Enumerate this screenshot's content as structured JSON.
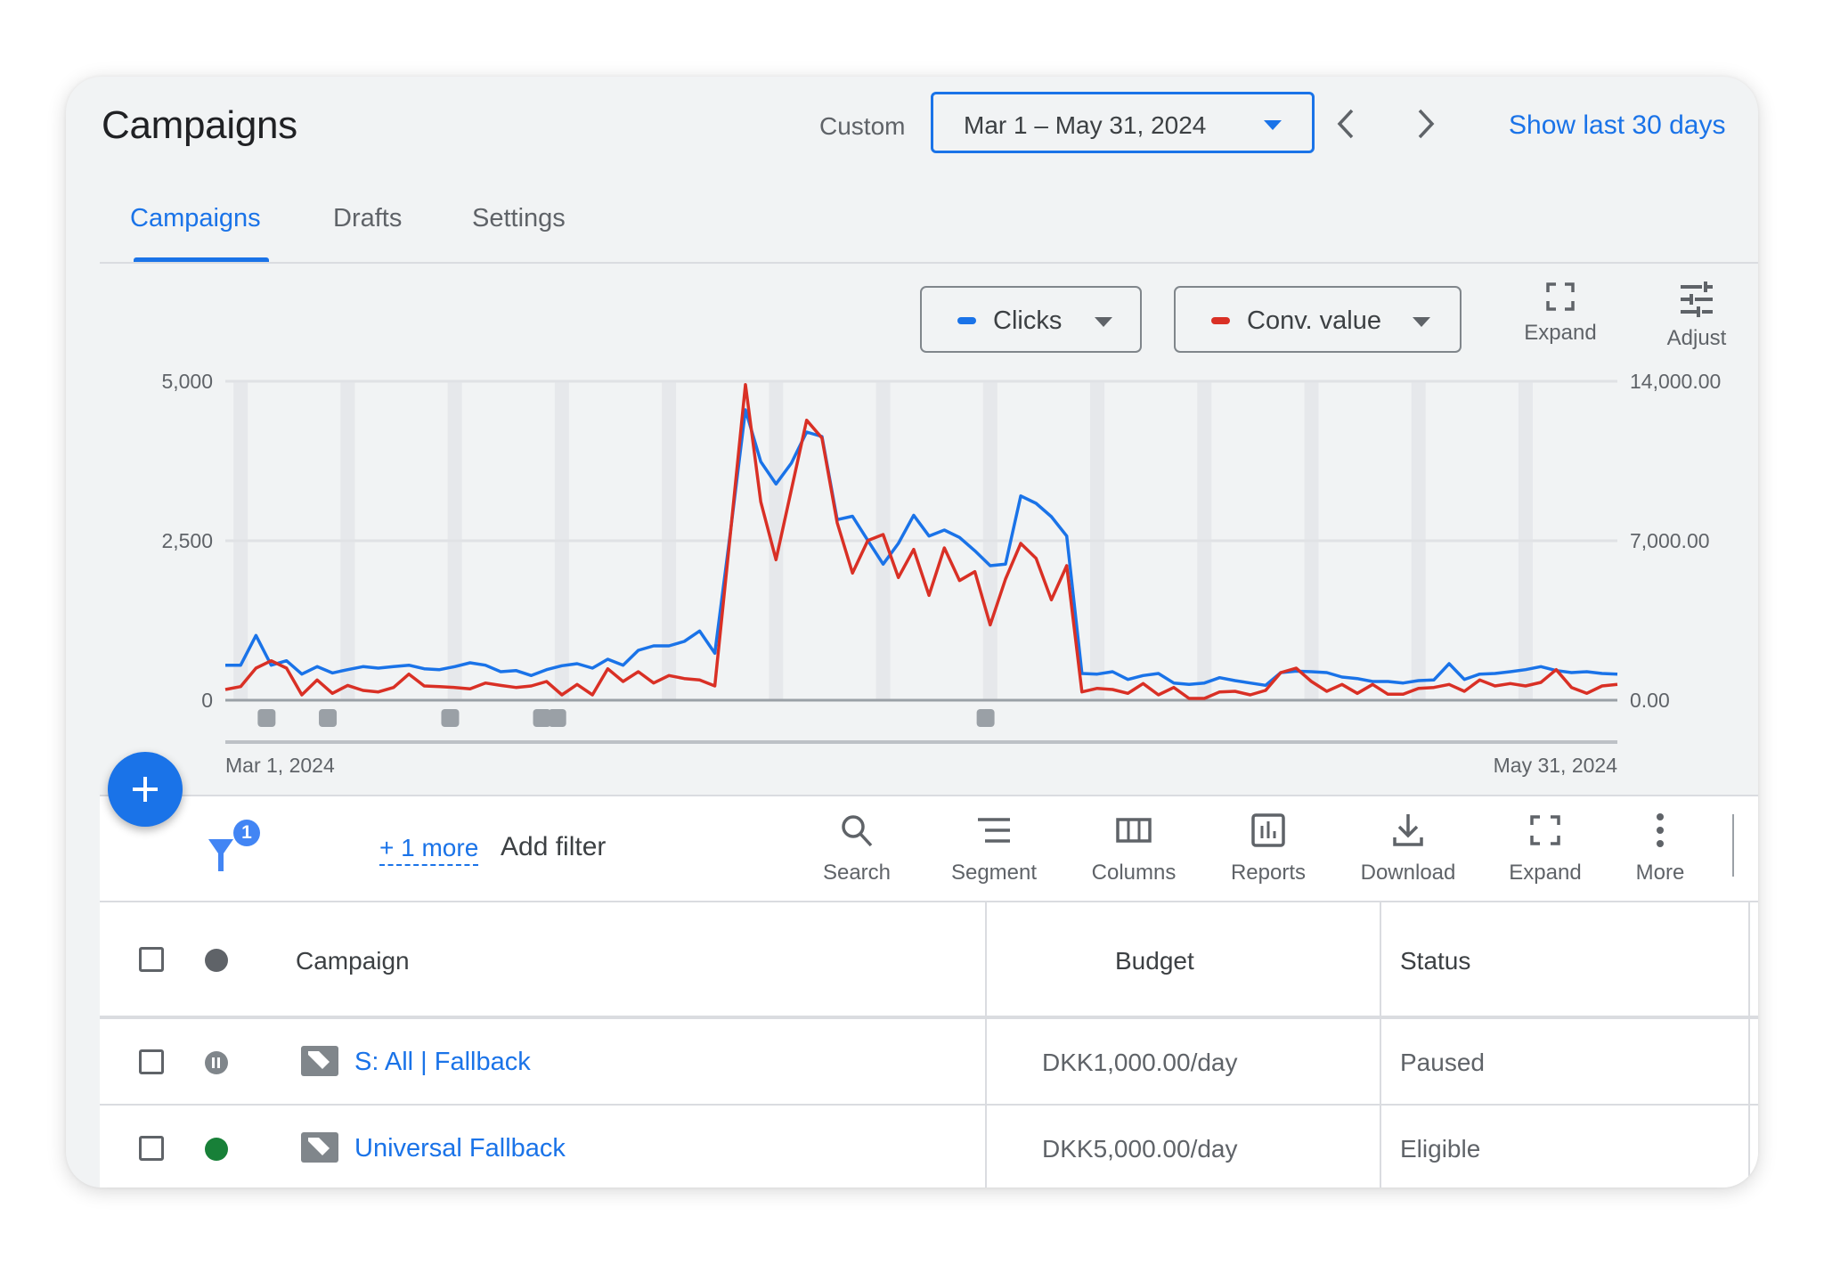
{
  "header": {
    "title": "Campaigns",
    "date_range_type": "Custom",
    "date_range": "Mar 1 – May 31, 2024",
    "show_last_link": "Show last 30 days"
  },
  "tabs": [
    {
      "label": "Campaigns",
      "active": true
    },
    {
      "label": "Drafts",
      "active": false
    },
    {
      "label": "Settings",
      "active": false
    }
  ],
  "chart_controls": {
    "metric1": {
      "label": "Clicks",
      "color": "#1a73e8"
    },
    "metric2": {
      "label": "Conv. value",
      "color": "#d93025"
    },
    "expand_label": "Expand",
    "adjust_label": "Adjust"
  },
  "chart_data": {
    "type": "line",
    "title": "",
    "xlabel": "",
    "x_start_label": "Mar 1, 2024",
    "x_end_label": "May 31, 2024",
    "grid": true,
    "legend": "top-right (metric selector chips)",
    "y_left": {
      "label": "Clicks",
      "ylim": [
        0,
        5000
      ],
      "ticks": [
        "0",
        "2,500",
        "5,000"
      ]
    },
    "y_right": {
      "label": "Conv. value",
      "ylim": [
        0,
        14000
      ],
      "ticks": [
        "0.00",
        "7,000.00",
        "14,000.00"
      ]
    },
    "series": [
      {
        "name": "Clicks",
        "axis": "left",
        "color": "#1a73e8",
        "values": [
          549,
          549,
          1015,
          549,
          619,
          409,
          526,
          428,
          479,
          526,
          503,
          526,
          549,
          493,
          479,
          526,
          587,
          549,
          447,
          465,
          387,
          479,
          540,
          573,
          503,
          642,
          549,
          782,
          852,
          852,
          922,
          1085,
          736,
          2600,
          4553,
          3739,
          3390,
          3715,
          4204,
          4134,
          2831,
          2884,
          2504,
          2132,
          2458,
          2900,
          2574,
          2667,
          2551,
          2342,
          2109,
          2132,
          3203,
          3086,
          2877,
          2574,
          419,
          409,
          447,
          325,
          387,
          419,
          270,
          247,
          270,
          354,
          307,
          270,
          233,
          433,
          456,
          447,
          433,
          363,
          340,
          293,
          293,
          270,
          307,
          317,
          573,
          325,
          409,
          419,
          447,
          479,
          526,
          465,
          433,
          447,
          419,
          409
        ]
      },
      {
        "name": "Conv. value",
        "axis": "right",
        "color": "#d93025",
        "values": [
          469,
          599,
          1408,
          1733,
          1408,
          235,
          886,
          300,
          651,
          430,
          365,
          560,
          1146,
          626,
          599,
          560,
          495,
          756,
          651,
          560,
          626,
          821,
          235,
          691,
          235,
          1381,
          821,
          1251,
          756,
          1082,
          951,
          886,
          626,
          7200,
          13855,
          8710,
          6167,
          9229,
          12292,
          11510,
          7795,
          5580,
          7012,
          7273,
          5384,
          6621,
          4602,
          6686,
          5253,
          5644,
          3306,
          5319,
          6882,
          6230,
          4407,
          5905,
          365,
          521,
          469,
          300,
          730,
          235,
          560,
          78,
          78,
          365,
          391,
          235,
          430,
          1212,
          1408,
          821,
          391,
          691,
          300,
          691,
          261,
          261,
          521,
          560,
          691,
          391,
          886,
          626,
          730,
          626,
          782,
          1342,
          560,
          300,
          626,
          691
        ]
      }
    ],
    "annotation_markers_day_index": [
      2,
      6,
      14,
      20,
      21,
      49
    ]
  },
  "toolbar": {
    "filter_count": "1",
    "more_filters": "+ 1 more",
    "add_filter": "Add filter",
    "buttons": [
      {
        "label": "Search",
        "icon": "search-icon"
      },
      {
        "label": "Segment",
        "icon": "segment-icon"
      },
      {
        "label": "Columns",
        "icon": "columns-icon"
      },
      {
        "label": "Reports",
        "icon": "reports-icon"
      },
      {
        "label": "Download",
        "icon": "download-icon"
      },
      {
        "label": "Expand",
        "icon": "expand-icon"
      },
      {
        "label": "More",
        "icon": "more-vert-icon"
      }
    ]
  },
  "table": {
    "columns": [
      "Campaign",
      "Budget",
      "Status"
    ],
    "rows": [
      {
        "campaign": "S: All | Fallback",
        "budget": "DKK1,000.00/day",
        "status": "Paused",
        "status_color": "#80868b"
      },
      {
        "campaign": "Universal Fallback",
        "budget": "DKK5,000.00/day",
        "status": "Eligible",
        "status_color": "#188038"
      }
    ]
  }
}
